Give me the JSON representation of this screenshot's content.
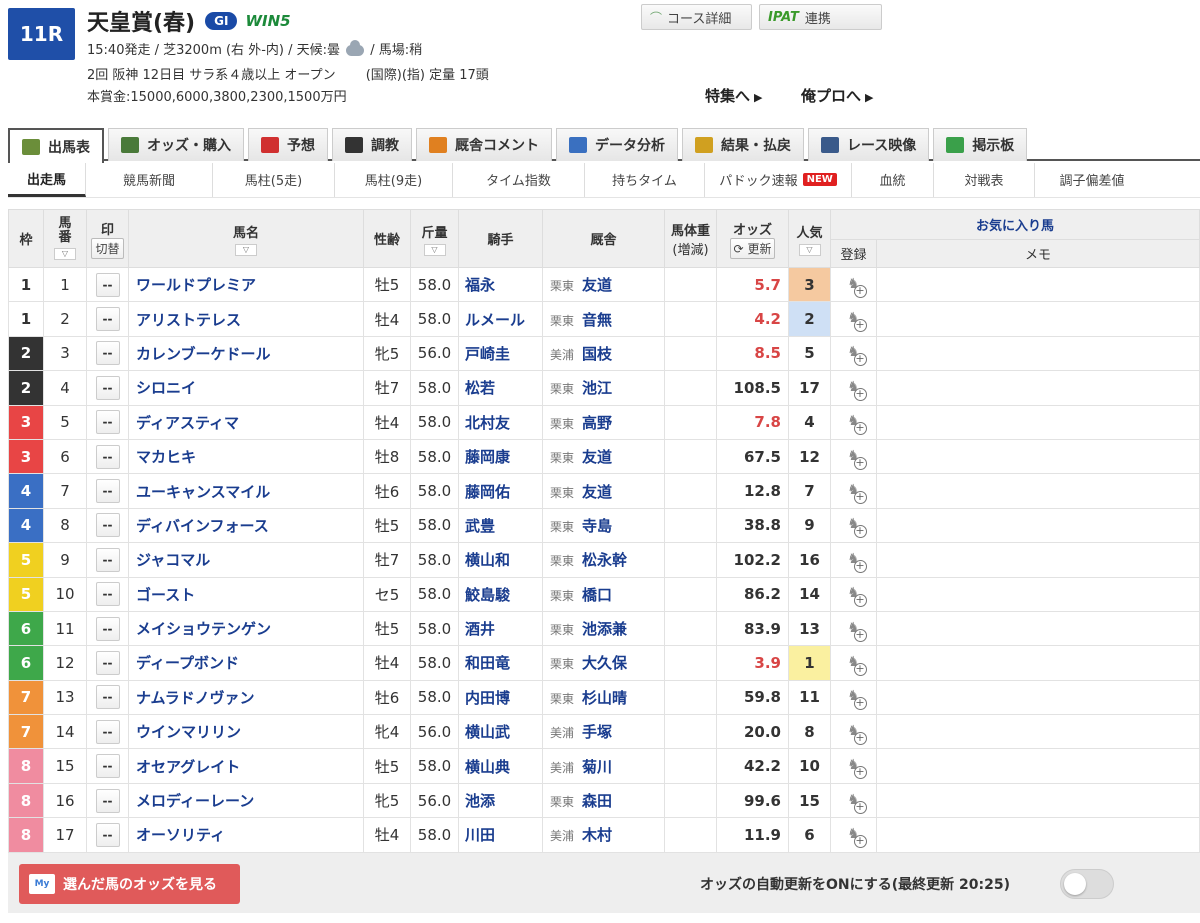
{
  "race": {
    "number": "11R",
    "title": "天皇賞(春)",
    "grade": "GI",
    "win5": "WIN5",
    "line1_pre": "15:40発走 / 芝3200m (右 外-内) / 天候:曇",
    "line1_post": "/ 馬場:稍",
    "line2": "2回 阪神 12日目 サラ系４歳以上 オープン 　　(国際)(指) 定量 17頭",
    "line3": "本賞金:15000,6000,3800,2300,1500万円"
  },
  "top_buttons": {
    "course": "コース詳細",
    "ipat_logo": "IPAT",
    "ipat": "連携"
  },
  "links": {
    "feature": "特集へ",
    "oreplo": "俺プロへ"
  },
  "tabs": [
    {
      "label": "出馬表",
      "icon": "table-icon",
      "color": "#6b8e3a"
    },
    {
      "label": "オッズ・購入",
      "icon": "odds-icon",
      "color": "#4a7a3a"
    },
    {
      "label": "予想",
      "icon": "target-icon",
      "color": "#d03030"
    },
    {
      "label": "調教",
      "icon": "stopwatch-icon",
      "color": "#333333"
    },
    {
      "label": "厩舎コメント",
      "icon": "stable-icon",
      "color": "#e08020"
    },
    {
      "label": "データ分析",
      "icon": "bar-chart-icon",
      "color": "#3a70c0"
    },
    {
      "label": "結果・払戻",
      "icon": "coins-icon",
      "color": "#d0a020"
    },
    {
      "label": "レース映像",
      "icon": "video-icon",
      "color": "#3a5a8a"
    },
    {
      "label": "掲示板",
      "icon": "chat-icon",
      "color": "#3aa04a"
    }
  ],
  "subnav": [
    {
      "label": "出走馬"
    },
    {
      "label": "競馬新聞"
    },
    {
      "label": "馬柱(5走)"
    },
    {
      "label": "馬柱(9走)"
    },
    {
      "label": "タイム指数"
    },
    {
      "label": "持ちタイム"
    },
    {
      "label": "パドック速報",
      "badge": "NEW"
    },
    {
      "label": "血統"
    },
    {
      "label": "対戦表"
    },
    {
      "label": "調子偏差値"
    }
  ],
  "headers": {
    "waku": "枠",
    "umaban": "馬番",
    "mark": "印",
    "mark_toggle": "切替",
    "horse": "馬名",
    "sexage": "性齢",
    "weight": "斤量",
    "jockey": "騎手",
    "stable": "厩舎",
    "bodyweight": "馬体重",
    "bodyweight_sub": "(増減)",
    "odds": "オッズ",
    "refresh": "更新",
    "popularity": "人気",
    "favorites": "お気に入り馬",
    "register": "登録",
    "memo": "メモ"
  },
  "waku_colors": {
    "1": {
      "bg": "#ffffff",
      "fg": "#333333"
    },
    "2": {
      "bg": "#333333",
      "fg": "#ffffff"
    },
    "3": {
      "bg": "#e84545",
      "fg": "#ffffff"
    },
    "4": {
      "bg": "#3a6fc4",
      "fg": "#ffffff"
    },
    "5": {
      "bg": "#f0d020",
      "fg": "#ffffff"
    },
    "6": {
      "bg": "#3ea84a",
      "fg": "#ffffff"
    },
    "7": {
      "bg": "#f0923a",
      "fg": "#ffffff"
    },
    "8": {
      "bg": "#f08ca0",
      "fg": "#ffffff"
    }
  },
  "rows": [
    {
      "waku": "1",
      "umaban": "1",
      "mark": "--",
      "horse": "ワールドプレミア",
      "sexage": "牡5",
      "weight": "58.0",
      "jockey": "福永",
      "area": "栗東",
      "trainer": "友道",
      "odds": "5.7",
      "hot": true,
      "pop": "3",
      "pop_bg": "#f5c9a0"
    },
    {
      "waku": "1",
      "umaban": "2",
      "mark": "--",
      "horse": "アリストテレス",
      "sexage": "牡4",
      "weight": "58.0",
      "jockey": "ルメール",
      "area": "栗東",
      "trainer": "音無",
      "odds": "4.2",
      "hot": true,
      "pop": "2",
      "pop_bg": "#cfe0f5"
    },
    {
      "waku": "2",
      "umaban": "3",
      "mark": "--",
      "horse": "カレンブーケドール",
      "sexage": "牝5",
      "weight": "56.0",
      "jockey": "戸崎圭",
      "area": "美浦",
      "trainer": "国枝",
      "odds": "8.5",
      "hot": true,
      "pop": "5",
      "pop_bg": ""
    },
    {
      "waku": "2",
      "umaban": "4",
      "mark": "--",
      "horse": "シロニイ",
      "sexage": "牡7",
      "weight": "58.0",
      "jockey": "松若",
      "area": "栗東",
      "trainer": "池江",
      "odds": "108.5",
      "hot": false,
      "pop": "17",
      "pop_bg": ""
    },
    {
      "waku": "3",
      "umaban": "5",
      "mark": "--",
      "horse": "ディアスティマ",
      "sexage": "牡4",
      "weight": "58.0",
      "jockey": "北村友",
      "area": "栗東",
      "trainer": "高野",
      "odds": "7.8",
      "hot": true,
      "pop": "4",
      "pop_bg": ""
    },
    {
      "waku": "3",
      "umaban": "6",
      "mark": "--",
      "horse": "マカヒキ",
      "sexage": "牡8",
      "weight": "58.0",
      "jockey": "藤岡康",
      "area": "栗東",
      "trainer": "友道",
      "odds": "67.5",
      "hot": false,
      "pop": "12",
      "pop_bg": ""
    },
    {
      "waku": "4",
      "umaban": "7",
      "mark": "--",
      "horse": "ユーキャンスマイル",
      "sexage": "牡6",
      "weight": "58.0",
      "jockey": "藤岡佑",
      "area": "栗東",
      "trainer": "友道",
      "odds": "12.8",
      "hot": false,
      "pop": "7",
      "pop_bg": ""
    },
    {
      "waku": "4",
      "umaban": "8",
      "mark": "--",
      "horse": "ディバインフォース",
      "sexage": "牡5",
      "weight": "58.0",
      "jockey": "武豊",
      "area": "栗東",
      "trainer": "寺島",
      "odds": "38.8",
      "hot": false,
      "pop": "9",
      "pop_bg": ""
    },
    {
      "waku": "5",
      "umaban": "9",
      "mark": "--",
      "horse": "ジャコマル",
      "sexage": "牡7",
      "weight": "58.0",
      "jockey": "横山和",
      "area": "栗東",
      "trainer": "松永幹",
      "odds": "102.2",
      "hot": false,
      "pop": "16",
      "pop_bg": ""
    },
    {
      "waku": "5",
      "umaban": "10",
      "mark": "--",
      "horse": "ゴースト",
      "sexage": "セ5",
      "weight": "58.0",
      "jockey": "鮫島駿",
      "area": "栗東",
      "trainer": "橋口",
      "odds": "86.2",
      "hot": false,
      "pop": "14",
      "pop_bg": ""
    },
    {
      "waku": "6",
      "umaban": "11",
      "mark": "--",
      "horse": "メイショウテンゲン",
      "sexage": "牡5",
      "weight": "58.0",
      "jockey": "酒井",
      "area": "栗東",
      "trainer": "池添兼",
      "odds": "83.9",
      "hot": false,
      "pop": "13",
      "pop_bg": ""
    },
    {
      "waku": "6",
      "umaban": "12",
      "mark": "--",
      "horse": "ディープボンド",
      "sexage": "牡4",
      "weight": "58.0",
      "jockey": "和田竜",
      "area": "栗東",
      "trainer": "大久保",
      "odds": "3.9",
      "hot": true,
      "pop": "1",
      "pop_bg": "#faf0a0"
    },
    {
      "waku": "7",
      "umaban": "13",
      "mark": "--",
      "horse": "ナムラドノヴァン",
      "sexage": "牡6",
      "weight": "58.0",
      "jockey": "内田博",
      "area": "栗東",
      "trainer": "杉山晴",
      "odds": "59.8",
      "hot": false,
      "pop": "11",
      "pop_bg": ""
    },
    {
      "waku": "7",
      "umaban": "14",
      "mark": "--",
      "horse": "ウインマリリン",
      "sexage": "牝4",
      "weight": "56.0",
      "jockey": "横山武",
      "area": "美浦",
      "trainer": "手塚",
      "odds": "20.0",
      "hot": false,
      "pop": "8",
      "pop_bg": ""
    },
    {
      "waku": "8",
      "umaban": "15",
      "mark": "--",
      "horse": "オセアグレイト",
      "sexage": "牡5",
      "weight": "58.0",
      "jockey": "横山典",
      "area": "美浦",
      "trainer": "菊川",
      "odds": "42.2",
      "hot": false,
      "pop": "10",
      "pop_bg": ""
    },
    {
      "waku": "8",
      "umaban": "16",
      "mark": "--",
      "horse": "メロディーレーン",
      "sexage": "牝5",
      "weight": "56.0",
      "jockey": "池添",
      "area": "栗東",
      "trainer": "森田",
      "odds": "99.6",
      "hot": false,
      "pop": "15",
      "pop_bg": ""
    },
    {
      "waku": "8",
      "umaban": "17",
      "mark": "--",
      "horse": "オーソリティ",
      "sexage": "牡4",
      "weight": "58.0",
      "jockey": "川田",
      "area": "美浦",
      "trainer": "木村",
      "odds": "11.9",
      "hot": false,
      "pop": "6",
      "pop_bg": ""
    }
  ],
  "footer": {
    "my_label": "My",
    "view_odds": "選んだ馬のオッズを見る",
    "auto_update": "オッズの自動更新をONにする(最終更新 20:25)",
    "toggle_on": false
  }
}
